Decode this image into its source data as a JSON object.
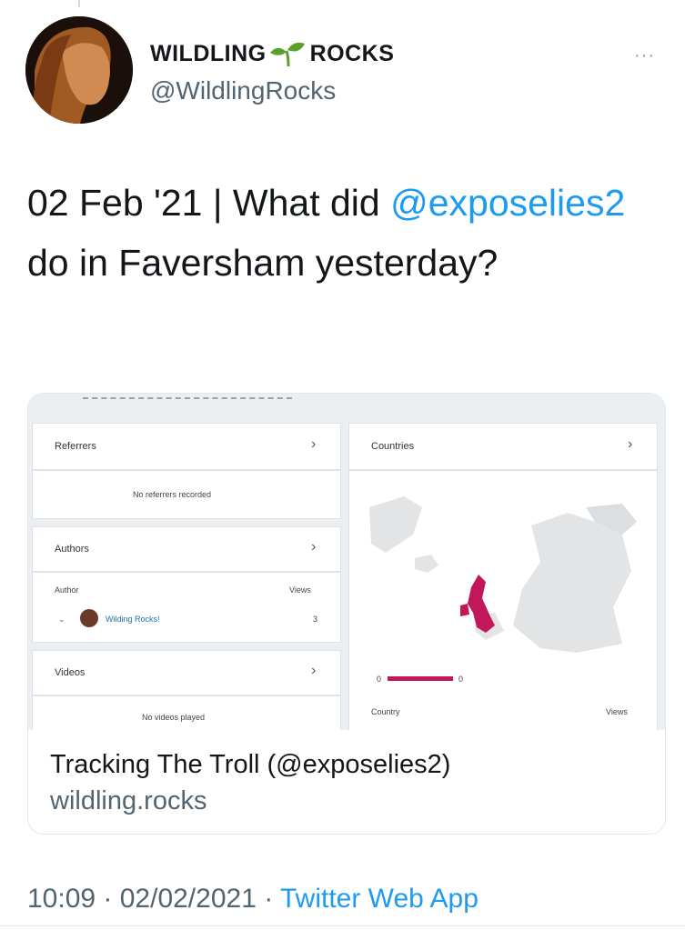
{
  "tweet": {
    "display_name_left": "WILDLING",
    "display_name_right": "ROCKS",
    "handle": "@WildlingRocks",
    "more_label": "···",
    "text_before": "02 Feb '21 | What did ",
    "mention": "@exposelies2",
    "text_after": " do in Faversham yesterday?",
    "meta_time": "10:09 · 02/02/2021 · ",
    "meta_app": "Twitter Web App"
  },
  "card": {
    "title": "Tracking The Troll (@exposelies2)",
    "domain": "wildling.rocks",
    "stats": {
      "referrers_title": "Referrers",
      "referrers_empty": "No referrers recorded",
      "authors_title": "Authors",
      "author_col": "Author",
      "views_col": "Views",
      "author_name": "Wilding Rocks!",
      "author_views": "3",
      "videos_title": "Videos",
      "videos_empty": "No videos played",
      "countries_title": "Countries",
      "country_col": "Country",
      "country_views_col": "Views",
      "legend_min": "0",
      "legend_max": "0"
    }
  },
  "colors": {
    "accent": "#1d9bf0",
    "map_highlight": "#c2185b",
    "sprout_green": "#5aa02c"
  }
}
